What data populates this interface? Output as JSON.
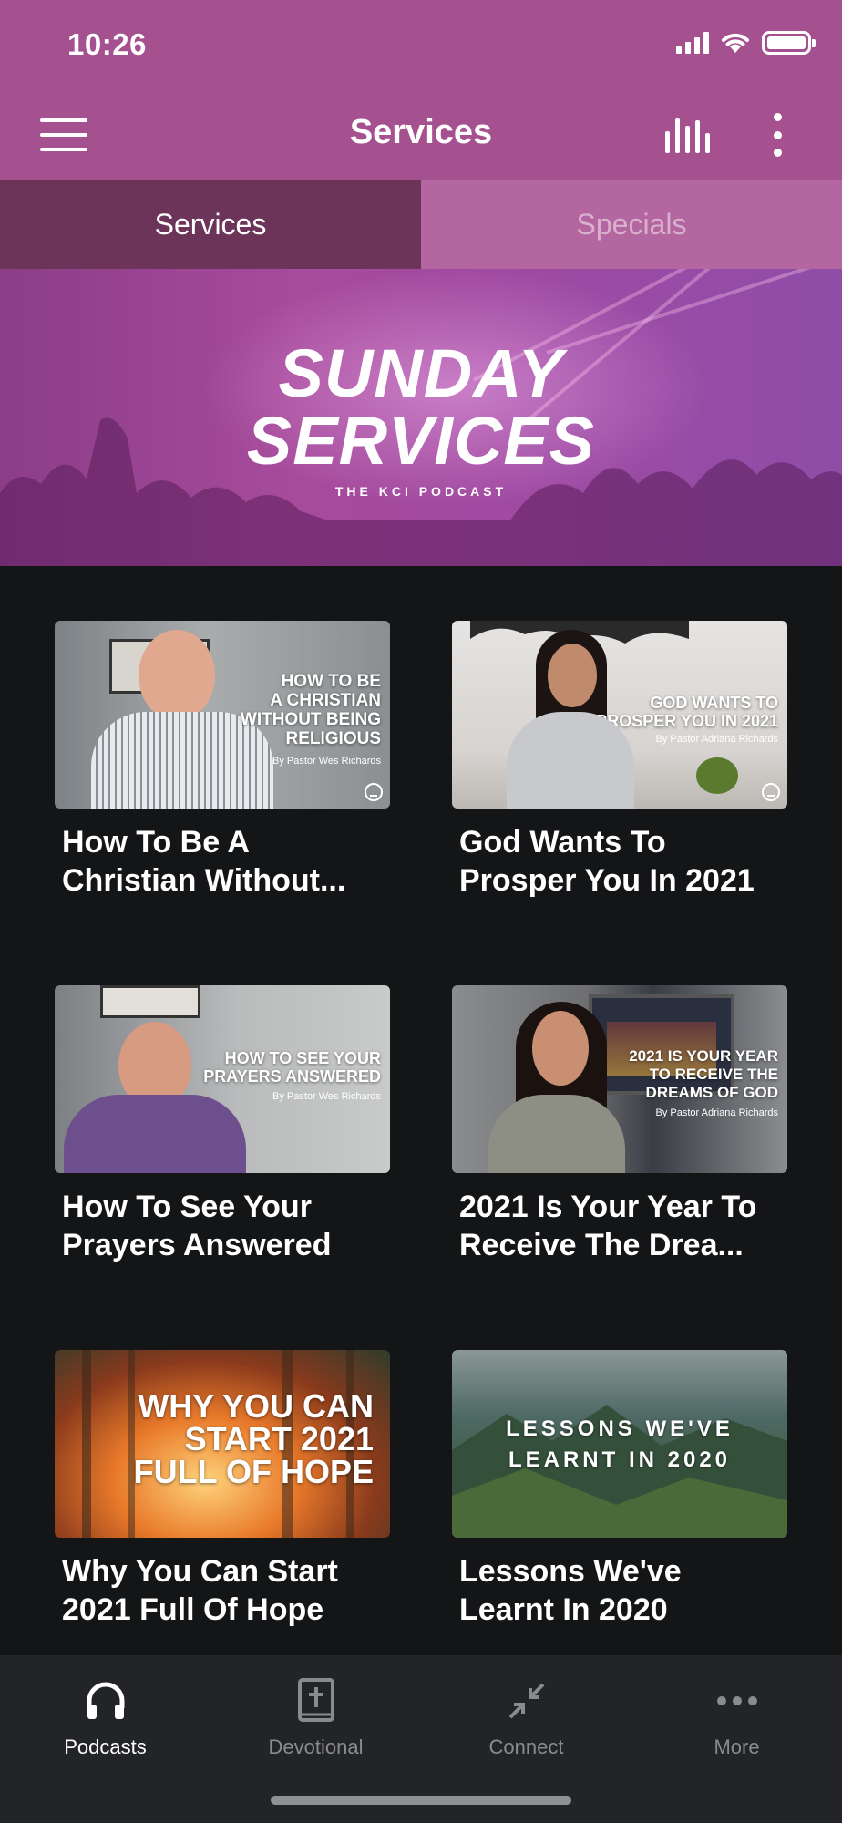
{
  "status_bar": {
    "time": "10:26"
  },
  "header": {
    "title": "Services"
  },
  "tabs": [
    {
      "label": "Services",
      "active": true
    },
    {
      "label": "Specials",
      "active": false
    }
  ],
  "banner": {
    "title_line1": "SUNDAY",
    "title_line2": "SERVICES",
    "subtitle": "THE KCI PODCAST"
  },
  "episodes": [
    {
      "title": "How To Be A\nChristian Without...",
      "thumb_text": "HOW TO BE\nA CHRISTIAN\nWITHOUT BEING\nRELIGIOUS",
      "thumb_author": "By Pastor Wes Richards"
    },
    {
      "title": "God Wants To\nProsper You In 2021",
      "thumb_text": "GOD WANTS TO\nPROSPER YOU IN 2021",
      "thumb_author": "By Pastor Adriana Richards"
    },
    {
      "title": "How To See Your\nPrayers Answered",
      "thumb_text": "HOW TO SEE YOUR\nPRAYERS ANSWERED",
      "thumb_author": "By Pastor Wes Richards"
    },
    {
      "title": "2021 Is Your Year To\nReceive The Drea...",
      "thumb_text": "2021 IS YOUR YEAR\nTO RECEIVE THE\nDREAMS OF GOD",
      "thumb_author": "By Pastor Adriana Richards"
    },
    {
      "title": "Why You Can Start\n2021 Full Of Hope",
      "thumb_text": "WHY YOU CAN\nSTART 2021\nFULL OF HOPE",
      "thumb_author": ""
    },
    {
      "title": "Lessons We've\nLearnt In 2020",
      "thumb_text": "LESSONS WE'VE\nLEARNT IN 2020",
      "thumb_author": ""
    }
  ],
  "bottom_nav": [
    {
      "label": "Podcasts",
      "icon": "headphones-icon",
      "active": true
    },
    {
      "label": "Devotional",
      "icon": "bible-icon",
      "active": false
    },
    {
      "label": "Connect",
      "icon": "connect-arrows-icon",
      "active": false
    },
    {
      "label": "More",
      "icon": "more-horizontal-icon",
      "active": false
    }
  ],
  "colors": {
    "header": "#a5508f",
    "tab_active": "#6c3458",
    "tab_inactive": "#b466a0",
    "background": "#141517",
    "nav": "#232427"
  }
}
